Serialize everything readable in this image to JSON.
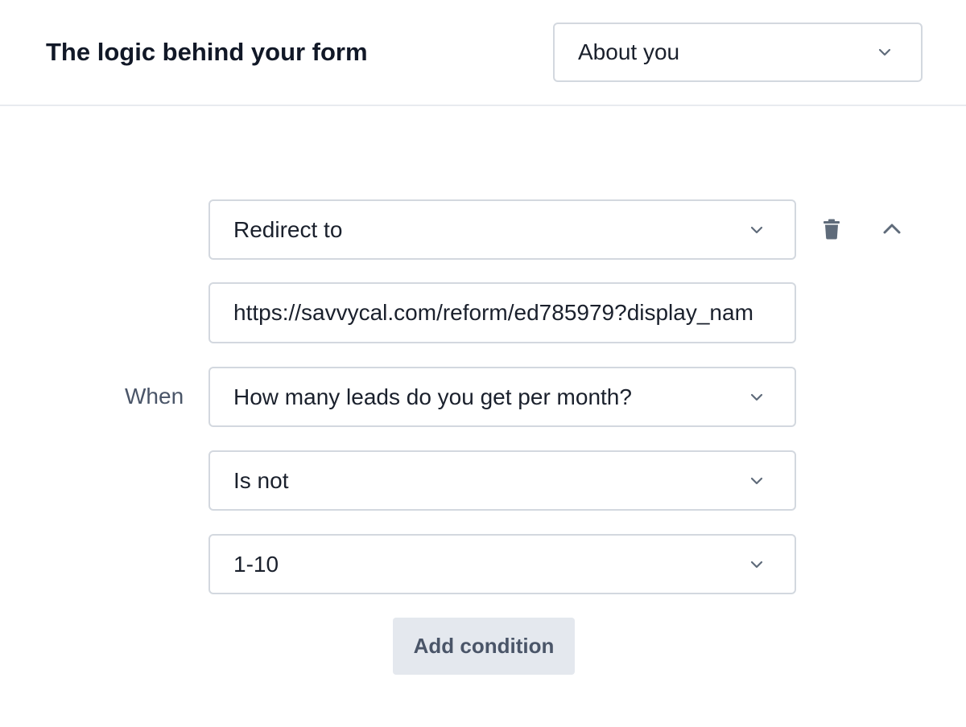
{
  "header": {
    "title": "The logic behind your form",
    "page_select": {
      "value": "About you"
    }
  },
  "rule": {
    "action": {
      "value": "Redirect to"
    },
    "redirect_url": {
      "value": "https://savvycal.com/reform/ed785979?display_nam"
    },
    "when_label": "When",
    "question": {
      "value": "How many leads do you get per month?"
    },
    "operator": {
      "value": "Is not"
    },
    "answer": {
      "value": "1-10"
    },
    "add_condition_label": "Add condition",
    "icons": {
      "delete": "trash-icon",
      "collapse": "chevron-up-icon",
      "dropdown": "chevron-down-icon"
    }
  },
  "colors": {
    "border": "#d3d8df",
    "icon": "#5f6b7a",
    "button_bg": "#e4e8ee",
    "button_text": "#4a5568",
    "label": "#4a5568"
  }
}
